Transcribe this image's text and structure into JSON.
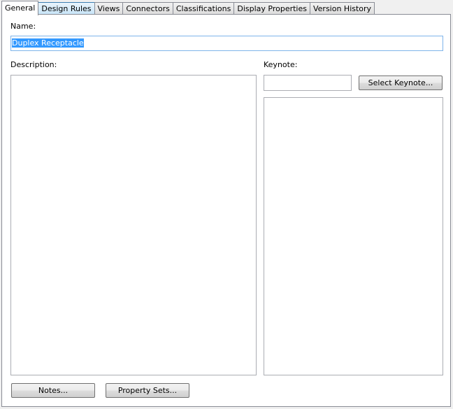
{
  "tabs": [
    {
      "label": "General"
    },
    {
      "label": "Design Rules"
    },
    {
      "label": "Views"
    },
    {
      "label": "Connectors"
    },
    {
      "label": "Classifications"
    },
    {
      "label": "Display Properties"
    },
    {
      "label": "Version History"
    }
  ],
  "general": {
    "name_label": "Name:",
    "name_value": "Duplex Receptacle",
    "description_label": "Description:",
    "description_value": "",
    "keynote_label": "Keynote:",
    "keynote_value": "",
    "keynote_text": "",
    "select_keynote_button": "Select Keynote...",
    "notes_button": "Notes...",
    "property_sets_button": "Property Sets..."
  }
}
